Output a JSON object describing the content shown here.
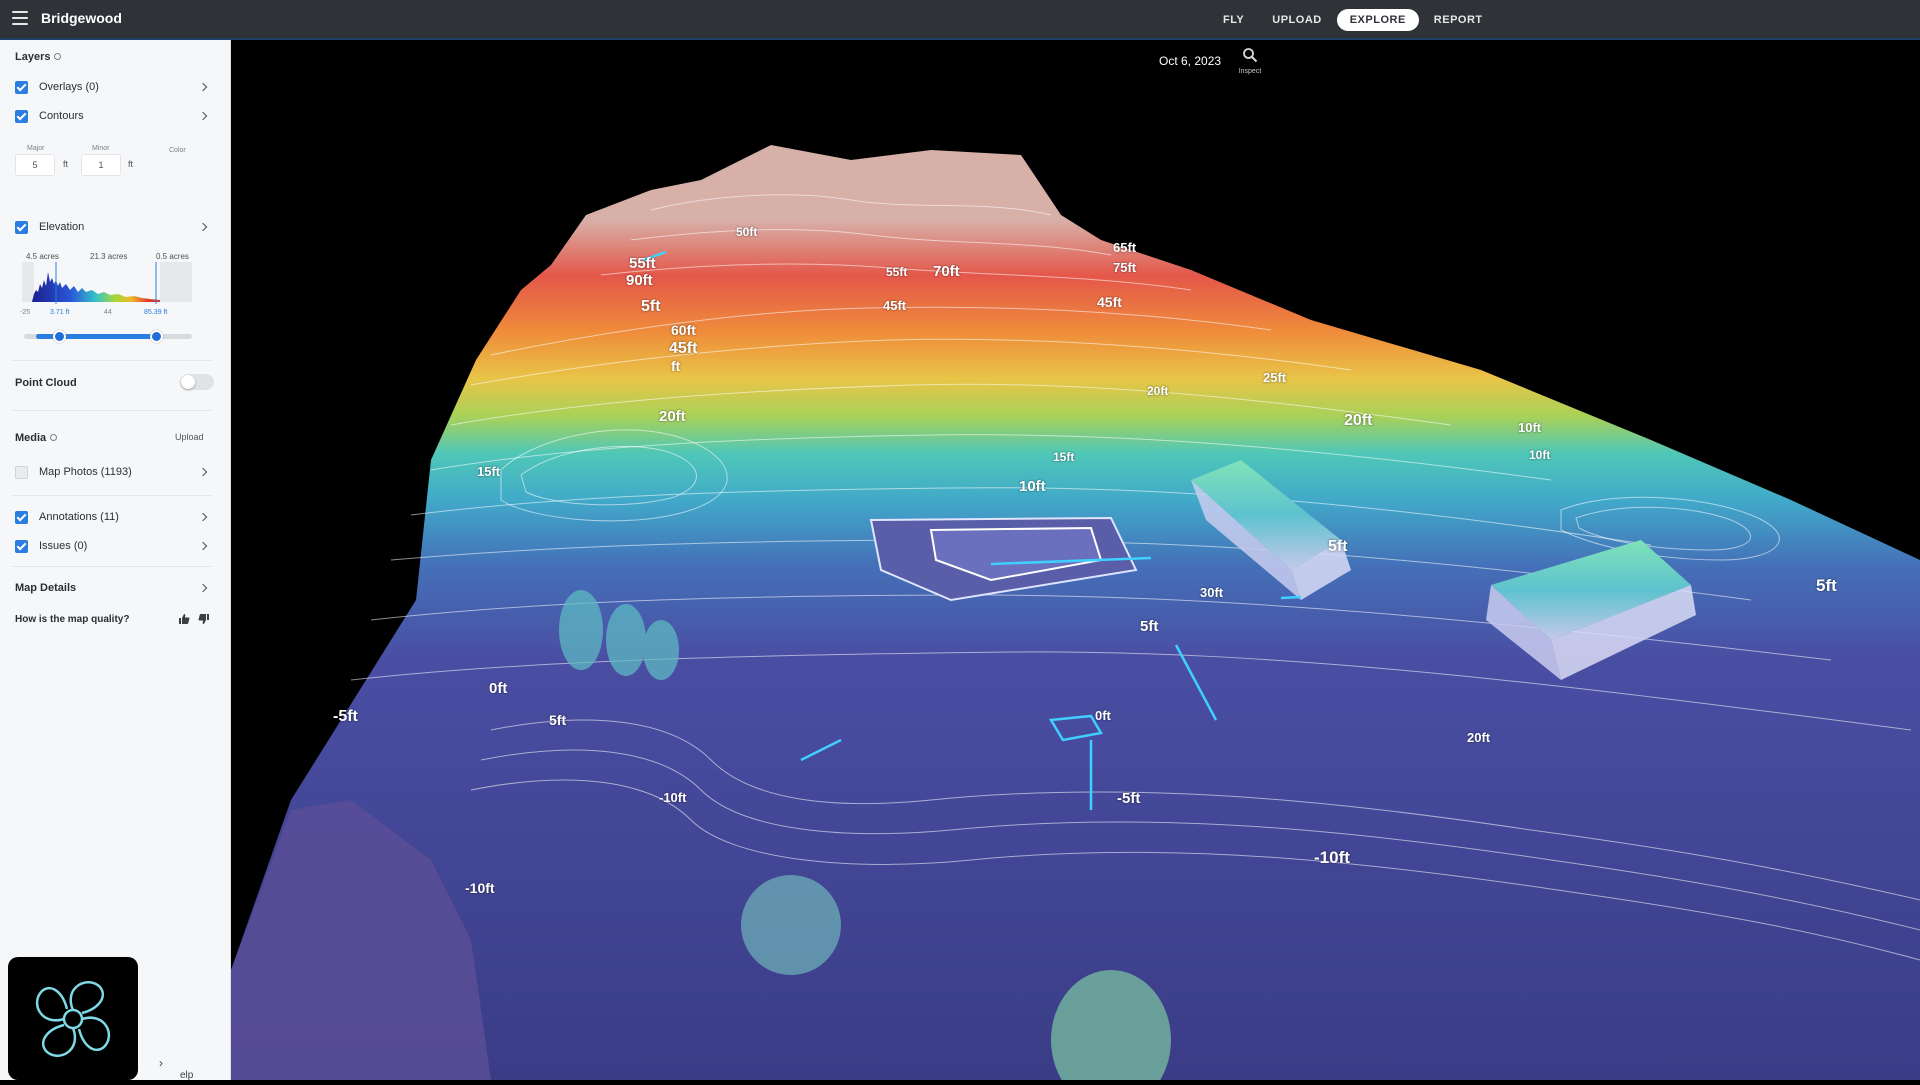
{
  "app": {
    "title": "Bridgewood"
  },
  "nav": {
    "fly": "FLY",
    "upload": "UPLOAD",
    "explore": "EXPLORE",
    "report": "REPORT",
    "active": "EXPLORE"
  },
  "toolbar": {
    "date": "Oct 6, 2023",
    "inspect_label": "Inspect"
  },
  "sidebar": {
    "layers_title": "Layers",
    "overlays": {
      "label": "Overlays (0)",
      "checked": true
    },
    "contours": {
      "label": "Contours",
      "checked": true,
      "major_label": "Major",
      "major_value": "5",
      "major_unit": "ft",
      "minor_label": "Minor",
      "minor_value": "1",
      "minor_unit": "ft",
      "color_label": "Color"
    },
    "elevation": {
      "label": "Elevation",
      "checked": true,
      "acres_left": "4.5 acres",
      "acres_mid": "21.3 acres",
      "acres_right": "0.5 acres",
      "tick_min": "-25",
      "tick_low": "3.71 ft",
      "tick_mid": "44",
      "tick_high": "85.39 ft"
    },
    "point_cloud": {
      "label": "Point Cloud",
      "enabled": false
    },
    "media_title": "Media",
    "media_upload": "Upload",
    "map_photos": {
      "label": "Map Photos (1193)",
      "checked": false
    },
    "annotations": {
      "label": "Annotations (11)",
      "checked": true
    },
    "issues": {
      "label": "Issues (0)",
      "checked": true
    },
    "map_details": "Map Details",
    "quality_question": "How is the map quality?",
    "help_label": "elp"
  },
  "map": {
    "contour_labels": [
      "55ft",
      "90ft",
      "5ft",
      "50ft",
      "45ft",
      "ft",
      "70ft",
      "55ft",
      "45ft",
      "60ft",
      "65ft",
      "75ft",
      "45ft",
      "20ft",
      "15ft",
      "10ft",
      "5ft",
      "0ft",
      "-5ft",
      "5ft",
      "0ft",
      "-10ft",
      "-5ft",
      "-10ft",
      "5ft",
      "30ft",
      "20ft",
      "10ft",
      "25ft",
      "20ft",
      "20ft",
      "15ft",
      "10ft",
      "-10ft",
      "5ft"
    ]
  },
  "colors": {
    "accent": "#2a7de1",
    "topbar": "#2f3337",
    "sidebar": "#f6f7f8",
    "terrain_low": "#3b3f8f",
    "terrain_mid": "#3fb8c0",
    "terrain_high": "#e24a3a"
  },
  "icons": {
    "menu": "hamburger-menu-icon",
    "inspect": "magnifier-icon",
    "info": "info-icon",
    "chevron": "chevron-right-icon",
    "thumb_up": "thumbs-up-icon",
    "thumb_down": "thumbs-down-icon",
    "map_2d": "map-icon",
    "map_3d": "cube-icon",
    "split": "split-view-icon"
  }
}
